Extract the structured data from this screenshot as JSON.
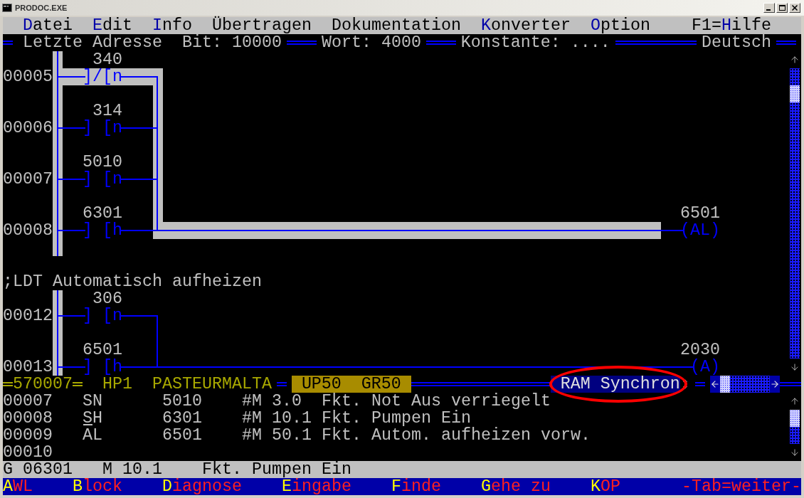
{
  "window": {
    "title": "PRODOC.EXE"
  },
  "menu": [
    {
      "parts": [
        {
          "text": "D",
          "hotkey": true
        },
        {
          "text": "atei",
          "hotkey": false
        }
      ]
    },
    {
      "parts": [
        {
          "text": "E",
          "hotkey": true
        },
        {
          "text": "dit",
          "hotkey": false
        }
      ]
    },
    {
      "parts": [
        {
          "text": "I",
          "hotkey": true
        },
        {
          "text": "nfo",
          "hotkey": false
        }
      ]
    },
    {
      "parts": [
        {
          "text": "Übertragen",
          "hotkey": false
        }
      ]
    },
    {
      "parts": [
        {
          "text": "Dokumentation",
          "hotkey": false
        }
      ]
    },
    {
      "parts": [
        {
          "text": "K",
          "hotkey": true
        },
        {
          "text": "onverter",
          "hotkey": false
        }
      ]
    },
    {
      "parts": [
        {
          "text": "O",
          "hotkey": true
        },
        {
          "text": "ption",
          "hotkey": false
        }
      ]
    },
    {
      "parts": [
        {
          "text": "F1=",
          "hotkey": false
        },
        {
          "text": "H",
          "hotkey": true
        },
        {
          "text": "ilfe",
          "hotkey": false
        }
      ]
    }
  ],
  "status_line": {
    "items": [
      "Letzte Adresse",
      "Bit: 10000",
      "Wort: 4000",
      "Konstante: ....",
      "Deutsch"
    ]
  },
  "ladder": {
    "networks": [
      {
        "highlighted": true,
        "rungs": [
          {
            "line": "00005",
            "address": "340",
            "contact": "]/[",
            "flag": "n"
          },
          {
            "line": "00006",
            "address": "314",
            "contact": "] [",
            "flag": "n"
          },
          {
            "line": "00007",
            "address": "5010",
            "contact": "] [",
            "flag": "n"
          },
          {
            "line": "00008",
            "address": "6301",
            "contact": "] [",
            "flag": "h"
          }
        ],
        "coil": {
          "address": "6501",
          "symbol": "(AL)"
        }
      },
      {
        "comment": ";LDT Automatisch aufheizen",
        "highlighted": false,
        "rungs": [
          {
            "line": "00012",
            "address": "306",
            "contact": "] [",
            "flag": "n"
          },
          {
            "line": "00013",
            "address": "6501",
            "contact": "] [",
            "flag": "h"
          }
        ],
        "coil": {
          "address": "2030",
          "symbol": "(A)"
        }
      }
    ]
  },
  "editor_status": {
    "counter": "570007",
    "module": "HP1",
    "project": "PASTEURMALTA",
    "tags": [
      "UP50",
      "GR50"
    ],
    "mode": {
      "text": "RAM Synchron",
      "circled": true
    }
  },
  "listing": {
    "rows": [
      {
        "line": "00007",
        "mnemonic": "SN",
        "address": "5010",
        "marker": "#M 3.0",
        "comment": "Fkt. Not Aus verriegelt",
        "cursor": false
      },
      {
        "line": "00008",
        "mnemonic": "SH",
        "address": "6301",
        "marker": "#M 10.1",
        "comment": "Fkt. Pumpen Ein",
        "cursor": true
      },
      {
        "line": "00009",
        "mnemonic": "AL",
        "address": "6501",
        "marker": "#M 50.1",
        "comment": "Fkt. Autom. aufheizen vorw.",
        "cursor": false
      },
      {
        "line": "00010"
      }
    ]
  },
  "info_bar": [
    "G 06301",
    "M 10.1",
    "Fkt. Pumpen Ein"
  ],
  "function_keys": [
    {
      "parts": [
        {
          "text": "A",
          "hotkey": true
        },
        {
          "text": "WL",
          "hotkey": false
        }
      ]
    },
    {
      "parts": [
        {
          "text": "B",
          "hotkey": true
        },
        {
          "text": "lock",
          "hotkey": false
        }
      ]
    },
    {
      "parts": [
        {
          "text": "D",
          "hotkey": true
        },
        {
          "text": "iagnose",
          "hotkey": false
        }
      ]
    },
    {
      "parts": [
        {
          "text": "E",
          "hotkey": true
        },
        {
          "text": "ingabe",
          "hotkey": false
        }
      ]
    },
    {
      "parts": [
        {
          "text": "F",
          "hotkey": true
        },
        {
          "text": "inde",
          "hotkey": false
        }
      ]
    },
    {
      "parts": [
        {
          "text": "G",
          "hotkey": true
        },
        {
          "text": "ehe zu",
          "hotkey": false
        }
      ]
    },
    {
      "parts": [
        {
          "text": "K",
          "hotkey": true
        },
        {
          "text": "OP",
          "hotkey": false
        }
      ]
    },
    {
      "parts": [
        {
          "text": "-Tab=weiter-",
          "hotkey": false
        }
      ]
    }
  ]
}
